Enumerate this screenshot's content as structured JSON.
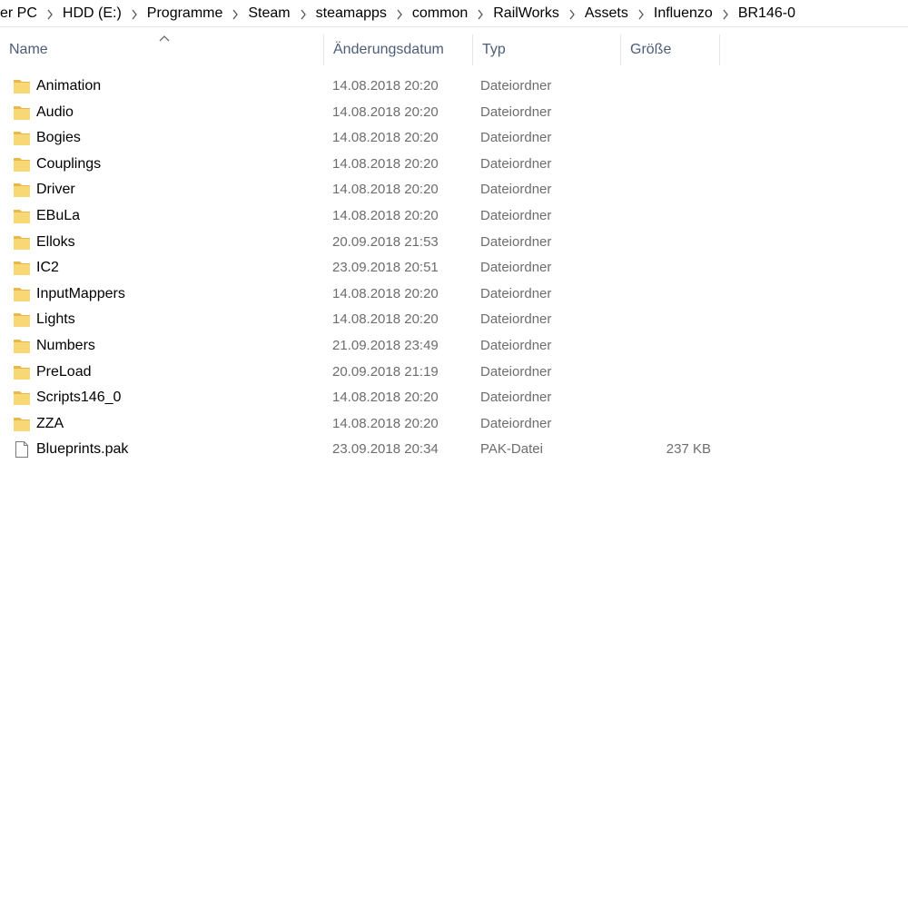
{
  "breadcrumb": [
    "er PC",
    "HDD (E:)",
    "Programme",
    "Steam",
    "steamapps",
    "common",
    "RailWorks",
    "Assets",
    "Influenzo",
    "BR146-0"
  ],
  "columns": {
    "name": "Name",
    "date": "Änderungsdatum",
    "type": "Typ",
    "size": "Größe"
  },
  "colors": {
    "folder": "#f8d775",
    "folder_dark": "#e8b84a",
    "header_text": "#4d5d79"
  },
  "files": [
    {
      "name": "Animation",
      "date": "14.08.2018 20:20",
      "type": "Dateiordner",
      "size": "",
      "icon": "folder-icon"
    },
    {
      "name": "Audio",
      "date": "14.08.2018 20:20",
      "type": "Dateiordner",
      "size": "",
      "icon": "folder-icon"
    },
    {
      "name": "Bogies",
      "date": "14.08.2018 20:20",
      "type": "Dateiordner",
      "size": "",
      "icon": "folder-icon"
    },
    {
      "name": "Couplings",
      "date": "14.08.2018 20:20",
      "type": "Dateiordner",
      "size": "",
      "icon": "folder-icon"
    },
    {
      "name": "Driver",
      "date": "14.08.2018 20:20",
      "type": "Dateiordner",
      "size": "",
      "icon": "folder-icon"
    },
    {
      "name": "EBuLa",
      "date": "14.08.2018 20:20",
      "type": "Dateiordner",
      "size": "",
      "icon": "folder-icon"
    },
    {
      "name": "Elloks",
      "date": "20.09.2018 21:53",
      "type": "Dateiordner",
      "size": "",
      "icon": "folder-icon"
    },
    {
      "name": "IC2",
      "date": "23.09.2018 20:51",
      "type": "Dateiordner",
      "size": "",
      "icon": "folder-icon"
    },
    {
      "name": "InputMappers",
      "date": "14.08.2018 20:20",
      "type": "Dateiordner",
      "size": "",
      "icon": "folder-icon"
    },
    {
      "name": "Lights",
      "date": "14.08.2018 20:20",
      "type": "Dateiordner",
      "size": "",
      "icon": "folder-icon"
    },
    {
      "name": "Numbers",
      "date": "21.09.2018 23:49",
      "type": "Dateiordner",
      "size": "",
      "icon": "folder-icon"
    },
    {
      "name": "PreLoad",
      "date": "20.09.2018 21:19",
      "type": "Dateiordner",
      "size": "",
      "icon": "folder-icon"
    },
    {
      "name": "Scripts146_0",
      "date": "14.08.2018 20:20",
      "type": "Dateiordner",
      "size": "",
      "icon": "folder-icon"
    },
    {
      "name": "ZZA",
      "date": "14.08.2018 20:20",
      "type": "Dateiordner",
      "size": "",
      "icon": "folder-icon"
    },
    {
      "name": "Blueprints.pak",
      "date": "23.09.2018 20:34",
      "type": "PAK-Datei",
      "size": "237 KB",
      "icon": "file-icon"
    }
  ]
}
